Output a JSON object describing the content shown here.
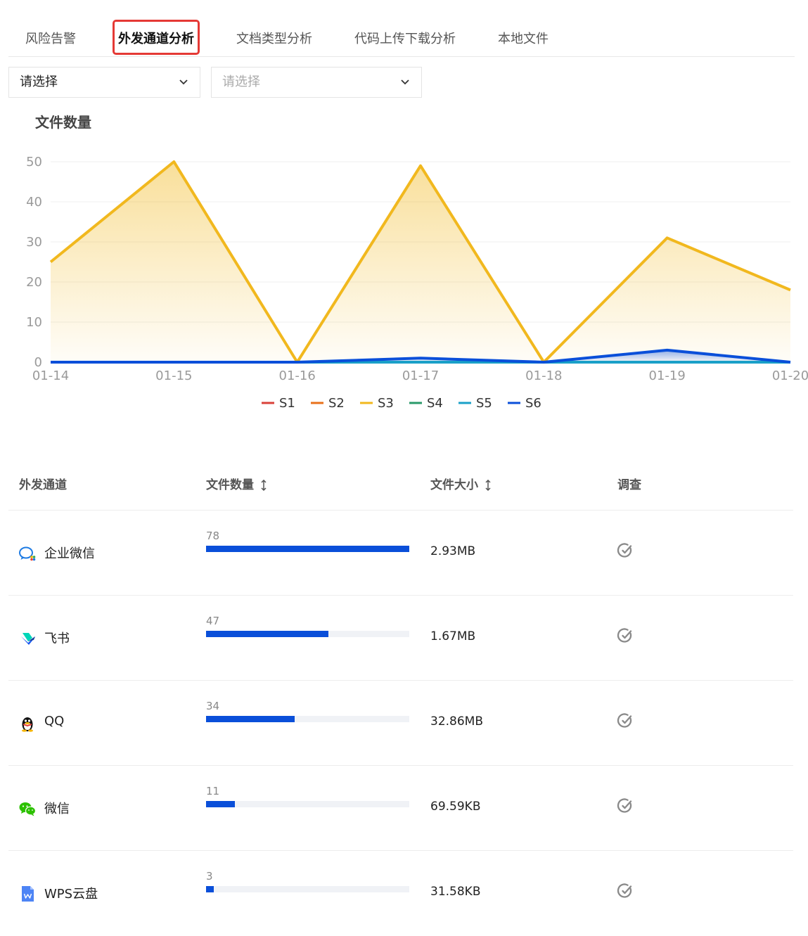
{
  "tabs": [
    {
      "label": "风险告警"
    },
    {
      "label": "外发通道分析"
    },
    {
      "label": "文档类型分析"
    },
    {
      "label": "代码上传下载分析"
    },
    {
      "label": "本地文件"
    }
  ],
  "filters": [
    {
      "value": "请选择",
      "placeholder": false
    },
    {
      "value": "请选择",
      "placeholder": true
    }
  ],
  "chart_data": {
    "type": "area",
    "title": "文件数量",
    "x": [
      "01-14",
      "01-15",
      "01-16",
      "01-17",
      "01-18",
      "01-19",
      "01-20"
    ],
    "ylim": [
      0,
      50
    ],
    "yticks": [
      0,
      10,
      20,
      30,
      40,
      50
    ],
    "grid": true,
    "legend_position": "bottom",
    "series": [
      {
        "name": "S1",
        "color": "#d9413a",
        "values": [
          0,
          0,
          0,
          0,
          0,
          0,
          0
        ]
      },
      {
        "name": "S2",
        "color": "#e8701a",
        "values": [
          0,
          0,
          0,
          0,
          0,
          0,
          0
        ]
      },
      {
        "name": "S3",
        "color": "#f1b81e",
        "values": [
          25,
          50,
          0,
          49,
          0,
          31,
          18
        ]
      },
      {
        "name": "S4",
        "color": "#2a9a6a",
        "values": [
          0,
          0,
          0,
          0,
          0,
          0,
          0
        ]
      },
      {
        "name": "S5",
        "color": "#1aa0c8",
        "values": [
          0,
          0,
          0,
          0,
          0,
          0,
          0
        ]
      },
      {
        "name": "S6",
        "color": "#0a4fd9",
        "values": [
          0,
          0,
          0,
          1,
          0,
          3,
          0
        ]
      }
    ]
  },
  "table": {
    "headers": {
      "channel": "外发通道",
      "count": "文件数量",
      "size": "文件大小",
      "investigate": "调查"
    },
    "max_count": 78,
    "rows": [
      {
        "channel": "企业微信",
        "icon": "wecom-icon",
        "count": 78,
        "size": "2.93MB"
      },
      {
        "channel": "飞书",
        "icon": "feishu-icon",
        "count": 47,
        "size": "1.67MB"
      },
      {
        "channel": "QQ",
        "icon": "qq-icon",
        "count": 34,
        "size": "32.86MB"
      },
      {
        "channel": "微信",
        "icon": "wechat-icon",
        "count": 11,
        "size": "69.59KB"
      },
      {
        "channel": "WPS云盘",
        "icon": "wps-cloud-icon",
        "count": 3,
        "size": "31.58KB"
      }
    ]
  }
}
